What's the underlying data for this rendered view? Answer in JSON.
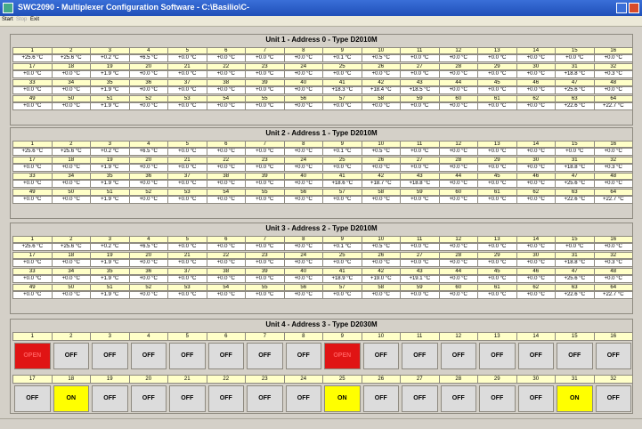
{
  "window": {
    "title": "SWC2090 - Multiplexer Configuration Software - C:\\Basilio\\C-",
    "minimize_icon": "minimize-icon",
    "close_icon": "close-icon"
  },
  "menu": {
    "items": [
      "Start",
      "Stop",
      "Exit"
    ],
    "disabled": [
      false,
      true,
      false
    ]
  },
  "units": [
    {
      "title": "Unit 1 - Address 0 - Type D2010M",
      "rows": [
        {
          "nums": [
            "1",
            "2",
            "3",
            "4",
            "5",
            "6",
            "7",
            "8",
            "9",
            "10",
            "11",
            "12",
            "13",
            "14",
            "15",
            "16"
          ],
          "vals": [
            "+25.6 °C",
            "+25.6 °C",
            "+0.2 °C",
            "+6.5 °C",
            "+0.0 °C",
            "+0.0 °C",
            "+0.0 °C",
            "+0.0 °C",
            "+0.1 °C",
            "+0.5 °C",
            "+0.0 °C",
            "+0.0 °C",
            "+0.0 °C",
            "+0.0 °C",
            "+0.0 °C",
            "+0.0 °C"
          ]
        },
        {
          "nums": [
            "17",
            "18",
            "19",
            "20",
            "21",
            "22",
            "23",
            "24",
            "25",
            "26",
            "27",
            "28",
            "29",
            "30",
            "31",
            "32"
          ],
          "vals": [
            "+0.0 °C",
            "+0.0 °C",
            "+1.9 °C",
            "+0.0 °C",
            "+0.0 °C",
            "+0.0 °C",
            "+0.0 °C",
            "+0.0 °C",
            "+0.0 °C",
            "+0.0 °C",
            "+0.0 °C",
            "+0.0 °C",
            "+0.0 °C",
            "+0.0 °C",
            "+18.8 °C",
            "+0.3 °C"
          ]
        },
        {
          "nums": [
            "33",
            "34",
            "35",
            "36",
            "37",
            "38",
            "39",
            "40",
            "41",
            "42",
            "43",
            "44",
            "45",
            "46",
            "47",
            "48"
          ],
          "vals": [
            "+0.0 °C",
            "+0.0 °C",
            "+1.9 °C",
            "+0.0 °C",
            "+0.0 °C",
            "+0.0 °C",
            "+0.0 °C",
            "+0.0 °C",
            "+18.3 °C",
            "+18.4 °C",
            "+18.5 °C",
            "+0.0 °C",
            "+0.0 °C",
            "+0.0 °C",
            "+25.6 °C",
            "+0.0 °C"
          ]
        },
        {
          "nums": [
            "49",
            "50",
            "51",
            "52",
            "53",
            "54",
            "55",
            "56",
            "57",
            "58",
            "59",
            "60",
            "61",
            "62",
            "63",
            "64"
          ],
          "vals": [
            "+0.0 °C",
            "+0.0 °C",
            "+1.9 °C",
            "+0.0 °C",
            "+0.0 °C",
            "+0.0 °C",
            "+0.0 °C",
            "+0.0 °C",
            "+0.0 °C",
            "+0.0 °C",
            "+0.0 °C",
            "+0.0 °C",
            "+0.0 °C",
            "+0.0 °C",
            "+22.6 °C",
            "+22.7 °C"
          ]
        }
      ]
    },
    {
      "title": "Unit 2 - Address 1 - Type D2010M",
      "rows": [
        {
          "nums": [
            "1",
            "2",
            "3",
            "4",
            "5",
            "6",
            "7",
            "8",
            "9",
            "10",
            "11",
            "12",
            "13",
            "14",
            "15",
            "16"
          ],
          "vals": [
            "+25.6 °C",
            "+25.6 °C",
            "+0.2 °C",
            "+6.5 °C",
            "+0.0 °C",
            "+0.0 °C",
            "+0.0 °C",
            "+0.0 °C",
            "+0.1 °C",
            "+0.5 °C",
            "+0.0 °C",
            "+0.0 °C",
            "+0.0 °C",
            "+0.0 °C",
            "+0.0 °C",
            "+0.0 °C"
          ]
        },
        {
          "nums": [
            "17",
            "18",
            "19",
            "20",
            "21",
            "22",
            "23",
            "24",
            "25",
            "26",
            "27",
            "28",
            "29",
            "30",
            "31",
            "32"
          ],
          "vals": [
            "+0.0 °C",
            "+0.0 °C",
            "+1.9 °C",
            "+0.0 °C",
            "+0.0 °C",
            "+0.0 °C",
            "+0.0 °C",
            "+0.0 °C",
            "+0.0 °C",
            "+0.0 °C",
            "+0.0 °C",
            "+0.0 °C",
            "+0.0 °C",
            "+0.0 °C",
            "+18.8 °C",
            "+0.3 °C"
          ]
        },
        {
          "nums": [
            "33",
            "34",
            "35",
            "36",
            "37",
            "38",
            "39",
            "40",
            "41",
            "42",
            "43",
            "44",
            "45",
            "46",
            "47",
            "48"
          ],
          "vals": [
            "+0.0 °C",
            "+0.0 °C",
            "+1.9 °C",
            "+0.0 °C",
            "+0.0 °C",
            "+0.0 °C",
            "+0.0 °C",
            "+0.0 °C",
            "+18.6 °C",
            "+18.7 °C",
            "+18.8 °C",
            "+0.0 °C",
            "+0.0 °C",
            "+0.0 °C",
            "+25.6 °C",
            "+0.0 °C"
          ]
        },
        {
          "nums": [
            "49",
            "50",
            "51",
            "52",
            "53",
            "54",
            "55",
            "56",
            "57",
            "58",
            "59",
            "60",
            "61",
            "62",
            "63",
            "64"
          ],
          "vals": [
            "+0.0 °C",
            "+0.0 °C",
            "+1.9 °C",
            "+0.0 °C",
            "+0.0 °C",
            "+0.0 °C",
            "+0.0 °C",
            "+0.0 °C",
            "+0.0 °C",
            "+0.0 °C",
            "+0.0 °C",
            "+0.0 °C",
            "+0.0 °C",
            "+0.0 °C",
            "+22.6 °C",
            "+22.7 °C"
          ]
        }
      ]
    },
    {
      "title": "Unit 3 - Address 2 - Type D2010M",
      "rows": [
        {
          "nums": [
            "1",
            "2",
            "3",
            "4",
            "5",
            "6",
            "7",
            "8",
            "9",
            "10",
            "11",
            "12",
            "13",
            "14",
            "15",
            "16"
          ],
          "vals": [
            "+25.6 °C",
            "+25.6 °C",
            "+0.2 °C",
            "+6.5 °C",
            "+0.0 °C",
            "+0.0 °C",
            "+0.0 °C",
            "+0.0 °C",
            "+0.1 °C",
            "+0.5 °C",
            "+0.0 °C",
            "+0.0 °C",
            "+0.0 °C",
            "+0.0 °C",
            "+0.0 °C",
            "+0.0 °C"
          ]
        },
        {
          "nums": [
            "17",
            "18",
            "19",
            "20",
            "21",
            "22",
            "23",
            "24",
            "25",
            "26",
            "27",
            "28",
            "29",
            "30",
            "31",
            "32"
          ],
          "vals": [
            "+0.0 °C",
            "+0.0 °C",
            "+1.9 °C",
            "+0.0 °C",
            "+0.0 °C",
            "+0.0 °C",
            "+0.0 °C",
            "+0.0 °C",
            "+0.0 °C",
            "+0.0 °C",
            "+0.0 °C",
            "+0.0 °C",
            "+0.0 °C",
            "+0.0 °C",
            "+18.8 °C",
            "+0.3 °C"
          ]
        },
        {
          "nums": [
            "33",
            "34",
            "35",
            "36",
            "37",
            "38",
            "39",
            "40",
            "41",
            "42",
            "43",
            "44",
            "45",
            "46",
            "47",
            "48"
          ],
          "vals": [
            "+0.0 °C",
            "+0.0 °C",
            "+1.9 °C",
            "+0.0 °C",
            "+0.0 °C",
            "+0.0 °C",
            "+0.0 °C",
            "+0.0 °C",
            "+18.9 °C",
            "+19.0 °C",
            "+19.1 °C",
            "+0.0 °C",
            "+0.0 °C",
            "+0.0 °C",
            "+25.6 °C",
            "+0.0 °C"
          ]
        },
        {
          "nums": [
            "49",
            "50",
            "51",
            "52",
            "53",
            "54",
            "55",
            "56",
            "57",
            "58",
            "59",
            "60",
            "61",
            "62",
            "63",
            "64"
          ],
          "vals": [
            "+0.0 °C",
            "+0.0 °C",
            "+1.9 °C",
            "+0.0 °C",
            "+0.0 °C",
            "+0.0 °C",
            "+0.0 °C",
            "+0.0 °C",
            "+0.0 °C",
            "+0.0 °C",
            "+0.0 °C",
            "+0.0 °C",
            "+0.0 °C",
            "+0.0 °C",
            "+22.6 °C",
            "+22.7 °C"
          ]
        }
      ]
    }
  ],
  "unit4": {
    "title": "Unit 4 - Address 3 - Type D2030M",
    "rows": [
      {
        "nums": [
          "1",
          "2",
          "3",
          "4",
          "5",
          "6",
          "7",
          "8",
          "9",
          "10",
          "11",
          "12",
          "13",
          "14",
          "15",
          "16"
        ],
        "states": [
          "OPEN",
          "OFF",
          "OFF",
          "OFF",
          "OFF",
          "OFF",
          "OFF",
          "OFF",
          "OPEN",
          "OFF",
          "OFF",
          "OFF",
          "OFF",
          "OFF",
          "OFF",
          "OFF"
        ]
      },
      {
        "nums": [
          "17",
          "18",
          "19",
          "20",
          "21",
          "22",
          "23",
          "24",
          "25",
          "26",
          "27",
          "28",
          "29",
          "30",
          "31",
          "32"
        ],
        "states": [
          "OFF",
          "ON",
          "OFF",
          "OFF",
          "OFF",
          "OFF",
          "OFF",
          "OFF",
          "ON",
          "OFF",
          "OFF",
          "OFF",
          "OFF",
          "OFF",
          "ON",
          "OFF"
        ]
      }
    ]
  }
}
